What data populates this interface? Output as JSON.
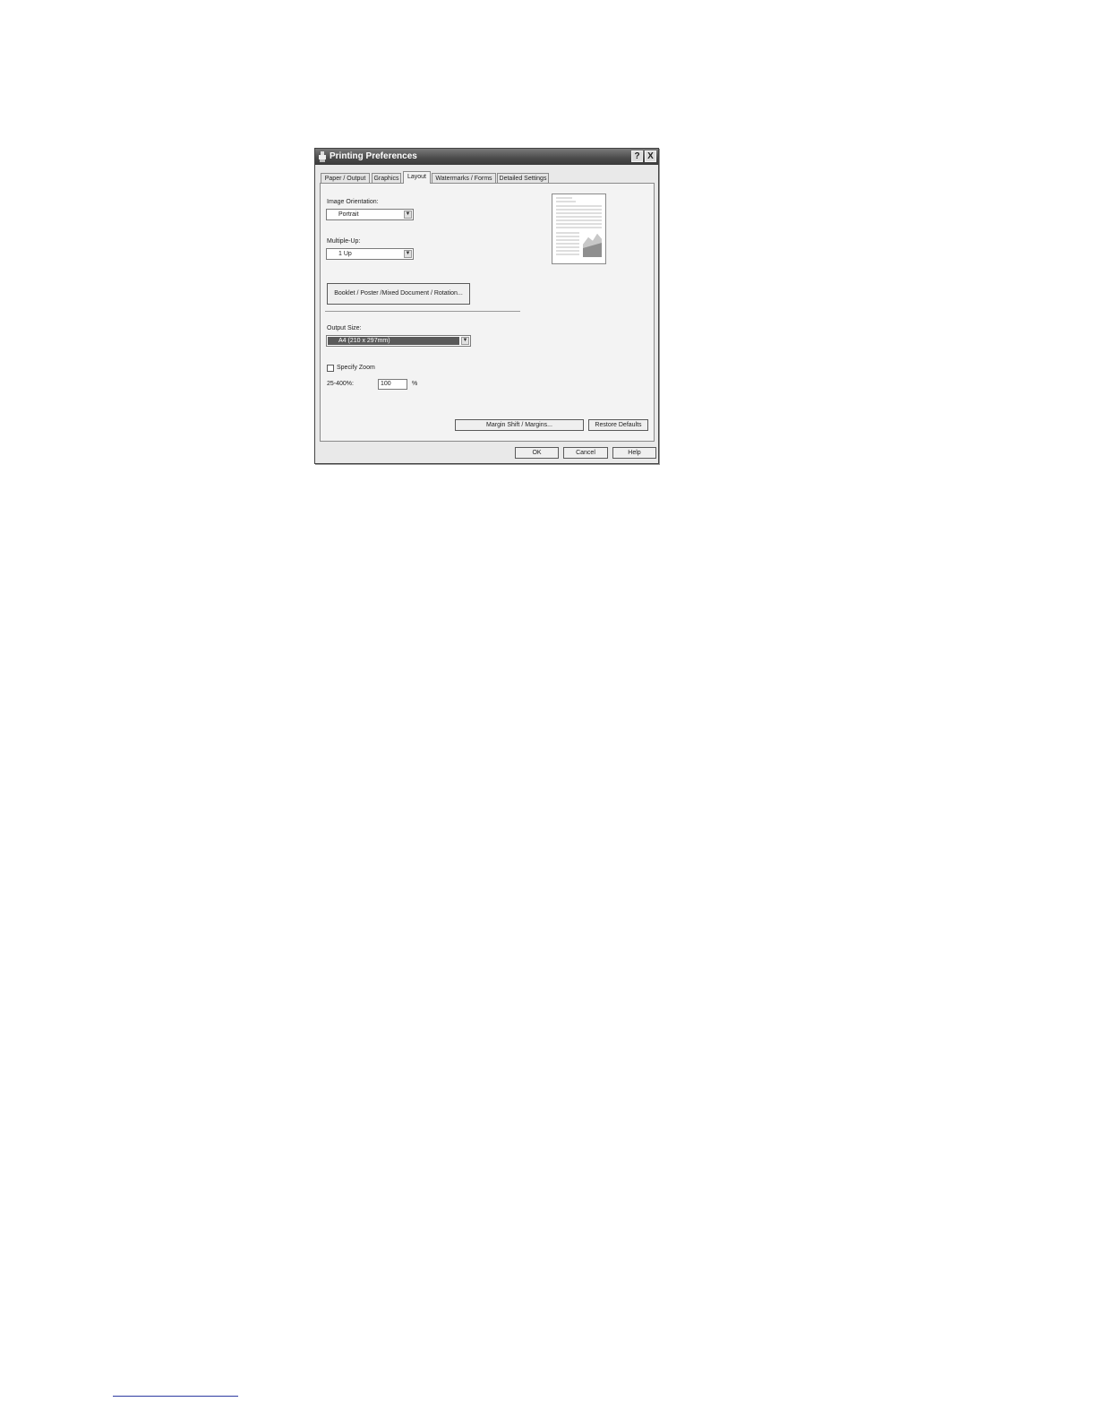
{
  "window": {
    "title": "Printing Preferences",
    "help_glyph": "?",
    "close_glyph": "X"
  },
  "tabs": [
    {
      "label": "Paper / Output",
      "active": false
    },
    {
      "label": "Graphics",
      "active": false
    },
    {
      "label": "Layout",
      "active": true
    },
    {
      "label": "Watermarks / Forms",
      "active": false
    },
    {
      "label": "Detailed Settings",
      "active": false
    }
  ],
  "layout": {
    "image_orientation_label": "Image Orientation:",
    "image_orientation_value": "Portrait",
    "multiple_up_label": "Multiple-Up:",
    "multiple_up_value": "1 Up",
    "booklet_button": "Booklet / Poster /Mixed Document / Rotation...",
    "output_size_label": "Output Size:",
    "output_size_value": "A4 (210 x 297mm)",
    "specify_zoom_label": "Specify Zoom",
    "zoom_range_label": "25-400%:",
    "zoom_value": "100",
    "zoom_unit": "%",
    "margin_button": "Margin Shift / Margins...",
    "restore_button": "Restore Defaults"
  },
  "footer_buttons": {
    "ok": "OK",
    "cancel": "Cancel",
    "help": "Help"
  },
  "icons": {
    "dropdown": "chevron-down-icon",
    "title": "printer-icon",
    "preview": "page-preview-icon"
  },
  "colors": {
    "titlebar": "#4a4a4a",
    "selection": "#5a5a5a"
  }
}
